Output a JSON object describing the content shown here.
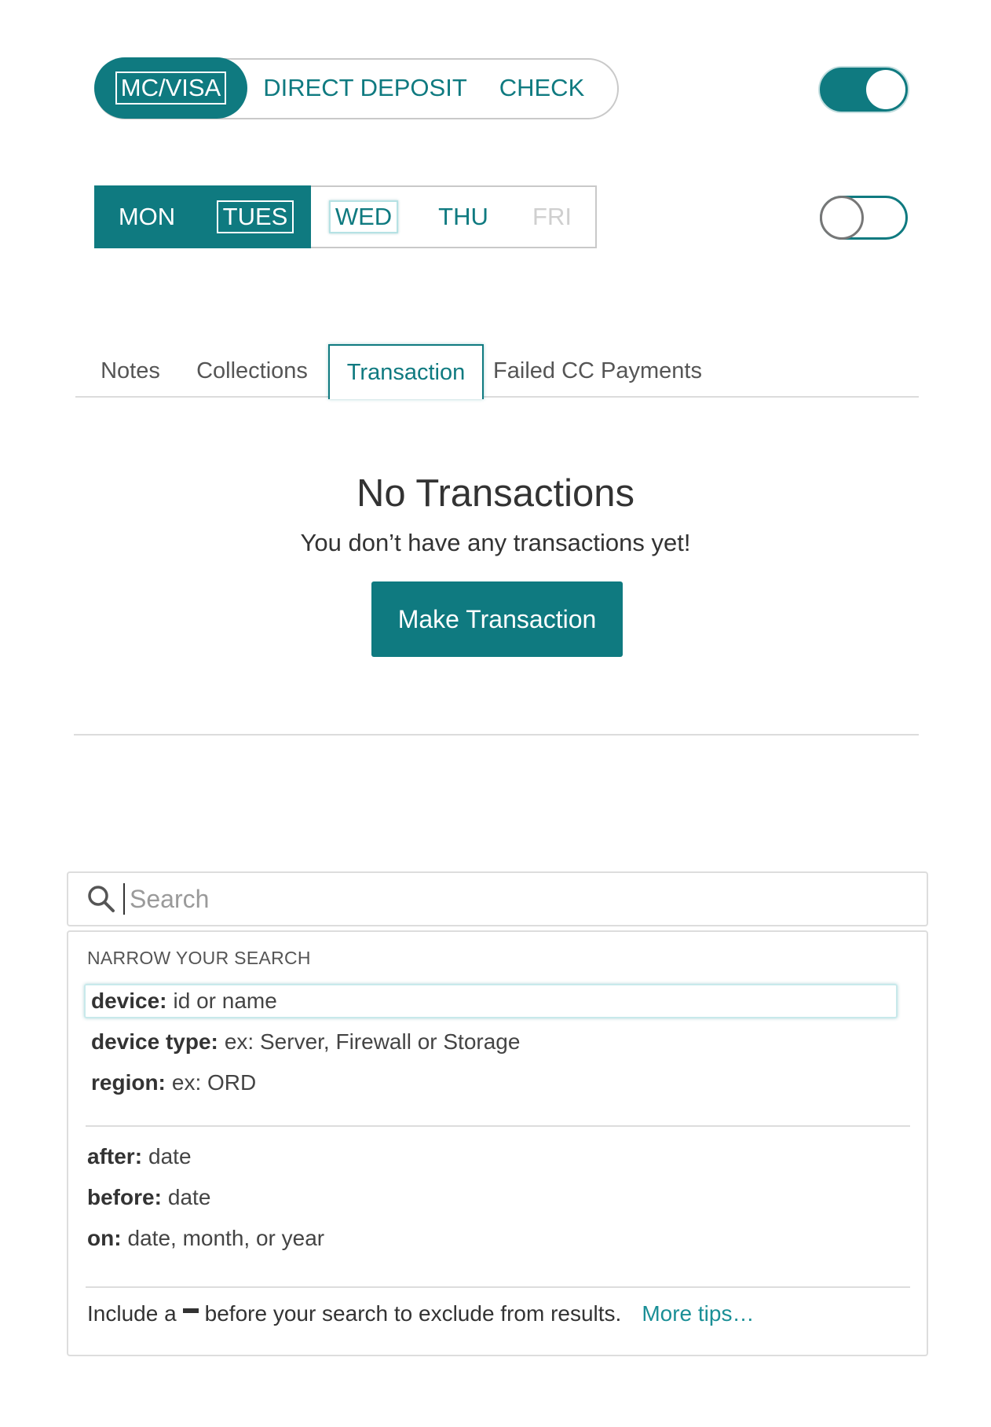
{
  "payment_methods": {
    "options": [
      "MC/VISA",
      "DIRECT DEPOSIT",
      "CHECK"
    ],
    "selected": "MC/VISA"
  },
  "toggles": {
    "toggle_1": "on",
    "toggle_2": "off"
  },
  "days": {
    "options": [
      "MON",
      "TUES",
      "WED",
      "THU",
      "FRI"
    ],
    "selected": [
      "MON",
      "TUES"
    ],
    "disabled": [
      "FRI"
    ]
  },
  "tabs": {
    "items": [
      "Notes",
      "Collections",
      "Transaction",
      "Failed CC Payments"
    ],
    "active": "Transaction"
  },
  "empty_state": {
    "title": "No Transactions",
    "message": "You don’t have any transactions yet!",
    "button_label": "Make Transaction"
  },
  "search": {
    "placeholder": "Search",
    "value": "",
    "heading": "NARROW YOUR SEARCH",
    "filters": [
      {
        "key": "device:",
        "hint": "id or name"
      },
      {
        "key": "device type:",
        "hint": "ex: Server, Firewall or Storage"
      },
      {
        "key": "region:",
        "hint": "ex: ORD"
      }
    ],
    "date_filters": [
      {
        "key": "after:",
        "hint": "date"
      },
      {
        "key": "before:",
        "hint": "date"
      },
      {
        "key": "on:",
        "hint": "date, month, or year"
      }
    ],
    "footer_before": "Include a",
    "footer_after": "before your search to exclude from results.",
    "more_tips": "More tips…"
  },
  "colors": {
    "accent": "#0f7a80",
    "link": "#1a8f96",
    "border": "#dddddd"
  }
}
